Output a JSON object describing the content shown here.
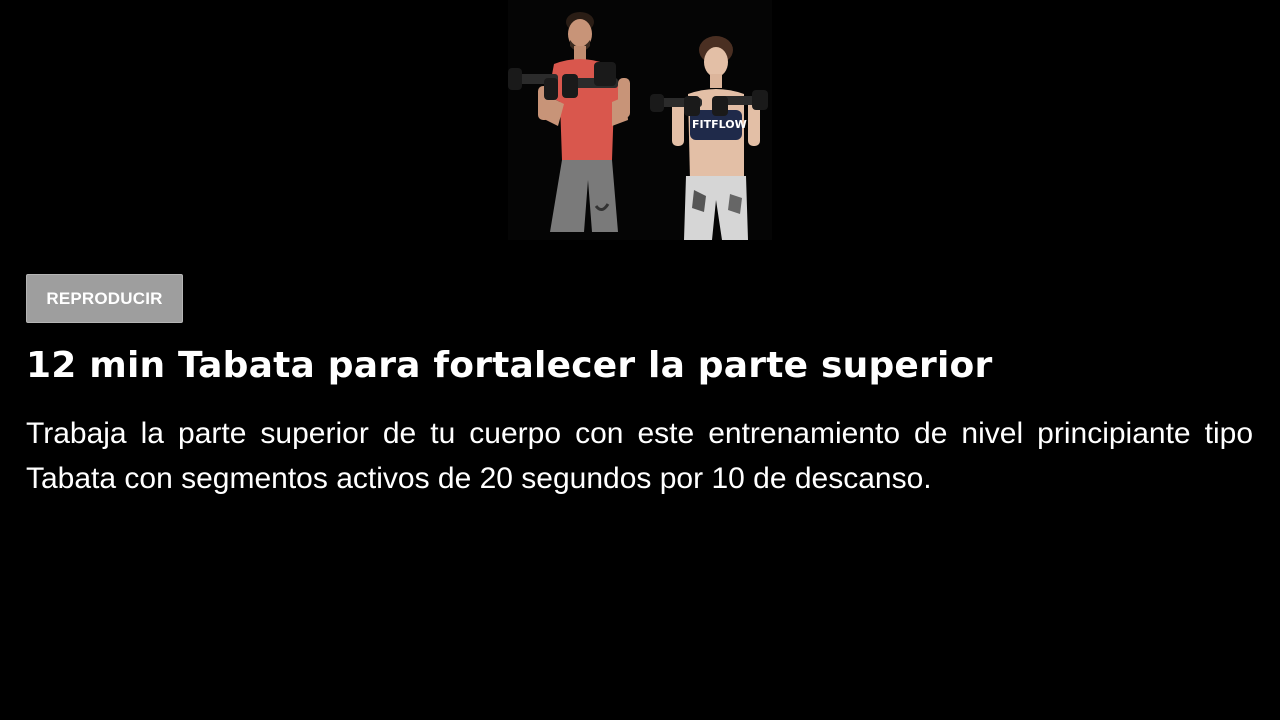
{
  "hero": {
    "image_name": "workout-hero-image",
    "shirt_print": "FITFLOW"
  },
  "actions": {
    "play_label": "REPRODUCIR"
  },
  "workout": {
    "title": "12 min Tabata para fortalecer la parte superior",
    "description": "Trabaja la parte superior de tu cuerpo con este entrenamiento de nivel principiante tipo Tabata con segmentos activos de 20 segundos por 10 de descanso."
  },
  "colors": {
    "background": "#000000",
    "button": "#9e9e9e",
    "text": "#ffffff"
  }
}
